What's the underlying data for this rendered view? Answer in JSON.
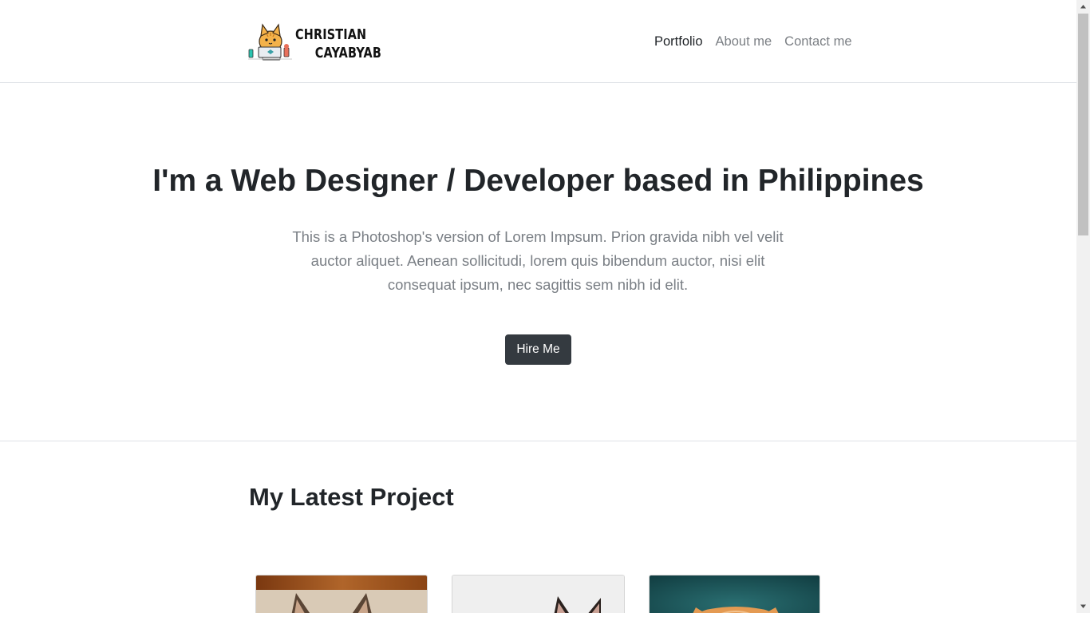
{
  "brand": {
    "line1": "CHRISTIAN",
    "line2": "CAYABYAB"
  },
  "nav": {
    "items": [
      "Portfolio",
      "About me",
      "Contact me"
    ]
  },
  "hero": {
    "title": "I'm a Web Designer / Developer based in Philippines",
    "lead": "This is a Photoshop's version of Lorem Impsum. Prion gravida nibh vel velit auctor aliquet. Aenean sollicitudi, lorem quis bibendum auctor, nisi elit consequat ipsum, nec sagittis sem nibh id elit.",
    "cta": "Hire Me"
  },
  "projects": {
    "heading": "My Latest Project"
  },
  "colors": {
    "dark": "#343a40",
    "muted": "#7a7f85",
    "border": "#dee2e6"
  }
}
